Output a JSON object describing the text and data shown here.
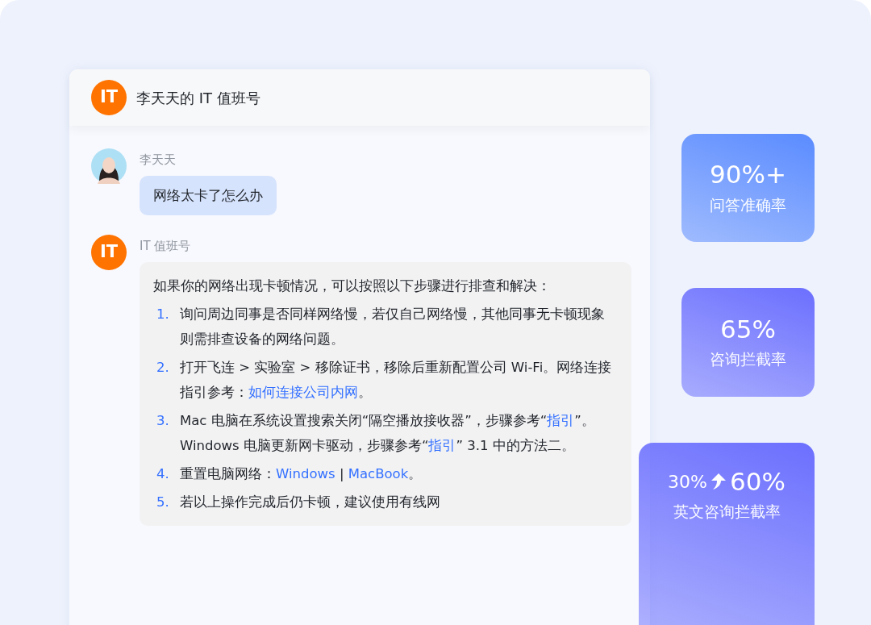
{
  "header": {
    "logo": "IT",
    "title": "李天天的 IT 值班号"
  },
  "messages": [
    {
      "kind": "user",
      "avatar": {
        "kind": "photo"
      },
      "sender": "李天天",
      "text": "网络太卡了怎么办"
    },
    {
      "kind": "bot",
      "avatar": {
        "kind": "logo",
        "text": "IT"
      },
      "sender": "IT 值班号",
      "intro": "如果你的网络出现卡顿情况，可以按照以下步骤进行排查和解决：",
      "steps": [
        {
          "number": "1.",
          "segments": [
            {
              "kind": "text",
              "text": "询问周边同事是否同样网络慢，若仅自己网络慢，其他同事无卡顿现象则需排查设备的网络问题。"
            }
          ]
        },
        {
          "number": "2.",
          "segments": [
            {
              "kind": "text",
              "text": "打开飞连 > 实验室 > 移除证书，移除后重新配置公司 Wi-Fi。网络连接指引参考："
            },
            {
              "kind": "link",
              "text": "如何连接公司内网"
            },
            {
              "kind": "text",
              "text": "。"
            }
          ]
        },
        {
          "number": "3.",
          "segments": [
            {
              "kind": "text",
              "text": "Mac 电脑在系统设置搜索关闭“隔空播放接收器”，步骤参考“"
            },
            {
              "kind": "link",
              "text": "指引"
            },
            {
              "kind": "text",
              "text": "”。Windows 电脑更新网卡驱动，步骤参考“"
            },
            {
              "kind": "link",
              "text": "指引"
            },
            {
              "kind": "text",
              "text": "” 3.1 中的方法二。"
            }
          ]
        },
        {
          "number": "4.",
          "segments": [
            {
              "kind": "text",
              "text": "重置电脑网络："
            },
            {
              "kind": "link",
              "text": "Windows"
            },
            {
              "kind": "text",
              "text": " | "
            },
            {
              "kind": "link",
              "text": "MacBook"
            },
            {
              "kind": "text",
              "text": "。"
            }
          ]
        },
        {
          "number": "5.",
          "segments": [
            {
              "kind": "text",
              "text": "若以上操作完成后仍卡顿，建议使用有线网"
            }
          ]
        }
      ]
    }
  ],
  "stats": [
    {
      "kind": "single",
      "value": "90%+",
      "label": "问答准确率",
      "color": "#5a8bff"
    },
    {
      "kind": "single",
      "value": "65%",
      "label": "咨询拦截率",
      "color": "#6b6ffe"
    },
    {
      "kind": "change",
      "from": "30%",
      "value": "60%",
      "label": "英文咨询拦截率",
      "color": "#6b6ffe"
    }
  ]
}
